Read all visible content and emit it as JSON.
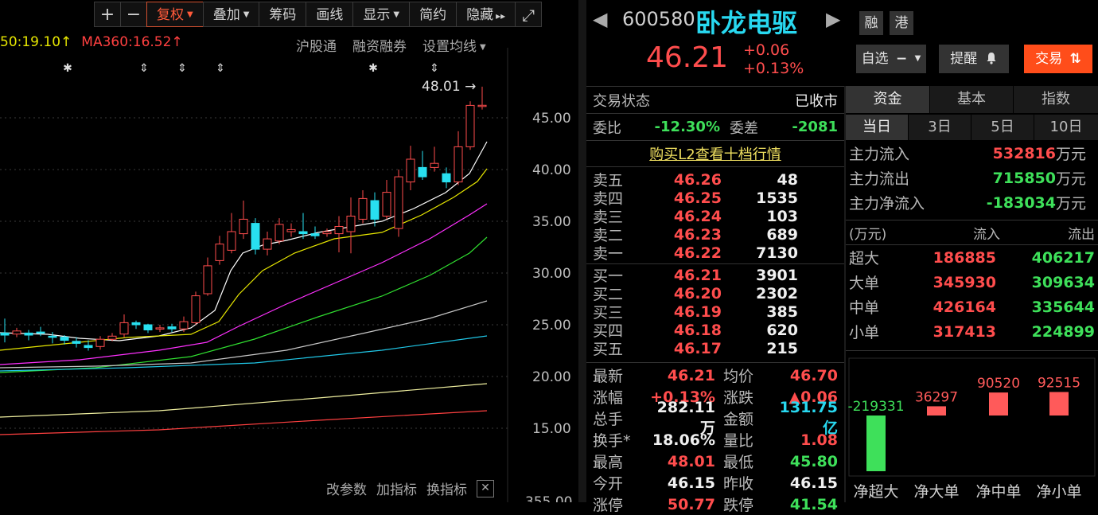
{
  "toolbar": {
    "zoom_in": "+",
    "zoom_out": "−",
    "fuquan": "复权",
    "overlay": "叠加",
    "chips": "筹码",
    "draw": "画线",
    "display": "显示",
    "simple": "简约",
    "hide": "隐藏",
    "hide_arrow": "▸▸",
    "fullscreen": "⤢"
  },
  "ma_legend": {
    "ma_partial": "50:19.10↑",
    "ma360": "MA360:16.52↑"
  },
  "quick_links": [
    "沪股通",
    "融资融券",
    "设置均线"
  ],
  "chart": {
    "max_label": "48.01",
    "price_axis": [
      "45.00",
      "40.00",
      "35.00",
      "30.00",
      "25.00",
      "20.00",
      "15.00"
    ],
    "bottom_cut_label": "355.00",
    "bottom_links": [
      "改参数",
      "加指标",
      "换指标"
    ],
    "close_x": "✕"
  },
  "chart_data": {
    "type": "candlestick",
    "y_ticks": [
      15,
      20,
      25,
      30,
      35,
      40,
      45
    ],
    "high_label": 48.01,
    "candles": [
      {
        "o": 24.2,
        "c": 24.0,
        "h": 25.6,
        "l": 23.3
      },
      {
        "o": 24.1,
        "c": 24.4,
        "h": 24.7,
        "l": 23.8
      },
      {
        "o": 24.2,
        "c": 24.0,
        "h": 24.5,
        "l": 23.5
      },
      {
        "o": 24.3,
        "c": 24.2,
        "h": 24.8,
        "l": 23.9
      },
      {
        "o": 23.9,
        "c": 23.8,
        "h": 24.3,
        "l": 23.2
      },
      {
        "o": 23.8,
        "c": 23.5,
        "h": 24.0,
        "l": 23.1
      },
      {
        "o": 23.4,
        "c": 23.2,
        "h": 23.8,
        "l": 22.8
      },
      {
        "o": 23.0,
        "c": 22.8,
        "h": 23.5,
        "l": 22.5
      },
      {
        "o": 22.9,
        "c": 23.6,
        "h": 23.9,
        "l": 22.6
      },
      {
        "o": 23.6,
        "c": 23.9,
        "h": 24.2,
        "l": 23.4
      },
      {
        "o": 24.1,
        "c": 25.2,
        "h": 26.0,
        "l": 23.8
      },
      {
        "o": 25.2,
        "c": 25.0,
        "h": 25.4,
        "l": 24.6
      },
      {
        "o": 25.0,
        "c": 24.5,
        "h": 25.1,
        "l": 24.2
      },
      {
        "o": 24.6,
        "c": 24.7,
        "h": 25.0,
        "l": 24.3
      },
      {
        "o": 24.8,
        "c": 24.6,
        "h": 25.1,
        "l": 24.3
      },
      {
        "o": 24.6,
        "c": 25.3,
        "h": 25.8,
        "l": 24.3
      },
      {
        "o": 25.2,
        "c": 27.8,
        "h": 28.2,
        "l": 25.0
      },
      {
        "o": 28.0,
        "c": 30.7,
        "h": 31.5,
        "l": 27.8
      },
      {
        "o": 31.2,
        "c": 32.8,
        "h": 33.6,
        "l": 30.8
      },
      {
        "o": 32.2,
        "c": 34.0,
        "h": 35.8,
        "l": 31.9
      },
      {
        "o": 33.8,
        "c": 35.2,
        "h": 37.0,
        "l": 33.3
      },
      {
        "o": 34.8,
        "c": 32.3,
        "h": 35.3,
        "l": 31.8
      },
      {
        "o": 32.3,
        "c": 33.3,
        "h": 34.0,
        "l": 31.7
      },
      {
        "o": 33.1,
        "c": 34.7,
        "h": 35.3,
        "l": 32.8
      },
      {
        "o": 34.0,
        "c": 34.2,
        "h": 34.8,
        "l": 33.5
      },
      {
        "o": 34.0,
        "c": 33.8,
        "h": 35.8,
        "l": 33.3
      },
      {
        "o": 33.8,
        "c": 33.6,
        "h": 34.5,
        "l": 33.3
      },
      {
        "o": 33.8,
        "c": 34.0,
        "h": 34.3,
        "l": 33.5
      },
      {
        "o": 33.8,
        "c": 34.5,
        "h": 35.5,
        "l": 32.0
      },
      {
        "o": 34.0,
        "c": 35.5,
        "h": 37.3,
        "l": 31.9
      },
      {
        "o": 35.2,
        "c": 37.2,
        "h": 38.0,
        "l": 34.8
      },
      {
        "o": 37.0,
        "c": 35.2,
        "h": 37.8,
        "l": 34.5
      },
      {
        "o": 35.5,
        "c": 37.8,
        "h": 39.0,
        "l": 35.2
      },
      {
        "o": 34.3,
        "c": 39.3,
        "h": 40.0,
        "l": 33.5
      },
      {
        "o": 38.8,
        "c": 41.0,
        "h": 42.3,
        "l": 38.0
      },
      {
        "o": 40.2,
        "c": 39.3,
        "h": 41.8,
        "l": 39.0
      },
      {
        "o": 40.2,
        "c": 40.6,
        "h": 42.2,
        "l": 39.8
      },
      {
        "o": 39.6,
        "c": 38.8,
        "h": 40.2,
        "l": 38.2
      },
      {
        "o": 38.8,
        "c": 42.2,
        "h": 43.7,
        "l": 38.5
      },
      {
        "o": 42.2,
        "c": 46.2,
        "h": 46.6,
        "l": 41.9
      },
      {
        "o": 46.15,
        "c": 46.21,
        "h": 48.01,
        "l": 45.8
      }
    ]
  },
  "quote": {
    "code": "600580",
    "name": "卧龙电驱",
    "tag_rong": "融",
    "tag_gang": "港",
    "price": "46.21",
    "change": "+0.06",
    "change_pct": "+0.13%",
    "watch_btn": "自选",
    "watch_icon": "−",
    "alert_btn": "提醒",
    "alert_icon": "bell-icon",
    "trade_btn": "交易",
    "trade_icon": "⇅"
  },
  "orderbook": {
    "status_label": "交易状态",
    "status_value": "已收市",
    "ratio_label": "委比",
    "ratio_value": "-12.30%",
    "diff_label": "委差",
    "diff_value": "-2081",
    "l2_link": "购买L2查看十档行情",
    "asks": [
      {
        "label": "卖五",
        "price": "46.26",
        "vol": "48"
      },
      {
        "label": "卖四",
        "price": "46.25",
        "vol": "1535"
      },
      {
        "label": "卖三",
        "price": "46.24",
        "vol": "103"
      },
      {
        "label": "卖二",
        "price": "46.23",
        "vol": "689"
      },
      {
        "label": "卖一",
        "price": "46.22",
        "vol": "7130"
      }
    ],
    "bids": [
      {
        "label": "买一",
        "price": "46.21",
        "vol": "3901"
      },
      {
        "label": "买二",
        "price": "46.20",
        "vol": "2302"
      },
      {
        "label": "买三",
        "price": "46.19",
        "vol": "385"
      },
      {
        "label": "买四",
        "price": "46.18",
        "vol": "620"
      },
      {
        "label": "买五",
        "price": "46.17",
        "vol": "215"
      }
    ]
  },
  "stats": [
    {
      "l1": "最新",
      "v1": "46.21",
      "l2": "均价",
      "v2": "46.70"
    },
    {
      "l1": "涨幅",
      "v1": "+0.13%",
      "l2": "涨跌",
      "v2": "▲0.06"
    },
    {
      "l1": "总手",
      "v1": "282.11万",
      "l2": "金额",
      "v2": "131.75亿"
    },
    {
      "l1": "换手*",
      "v1": "18.06%",
      "l2": "量比",
      "v2": "1.08"
    },
    {
      "l1": "最高",
      "v1": "48.01",
      "l2": "最低",
      "v2": "45.80"
    },
    {
      "l1": "今开",
      "v1": "46.15",
      "l2": "昨收",
      "v2": "46.15"
    },
    {
      "l1": "涨停",
      "v1": "50.77",
      "l2": "跌停",
      "v2": "41.54"
    }
  ],
  "fund": {
    "tabs": [
      "资金",
      "基本",
      "指数"
    ],
    "periods": [
      "当日",
      "3日",
      "5日",
      "10日"
    ],
    "inflow_label": "主力流入",
    "inflow_value": "532816",
    "outflow_label": "主力流出",
    "outflow_value": "715850",
    "net_label": "主力净流入",
    "net_value": "-183034",
    "unit": "万元",
    "table_unit": "(万元)",
    "col_in": "流入",
    "col_out": "流出",
    "rows": [
      {
        "label": "超大",
        "in": "186885",
        "out": "406217"
      },
      {
        "label": "大单",
        "in": "345930",
        "out": "309634"
      },
      {
        "label": "中单",
        "in": "426164",
        "out": "335644"
      },
      {
        "label": "小单",
        "in": "317413",
        "out": "224899"
      }
    ],
    "bars": [
      {
        "label": "净超大",
        "value": -219331,
        "text": "-219331"
      },
      {
        "label": "净大单",
        "value": 36297,
        "text": "36297"
      },
      {
        "label": "净中单",
        "value": 90520,
        "text": "90520"
      },
      {
        "label": "净小单",
        "value": 92515,
        "text": "92515"
      }
    ]
  }
}
